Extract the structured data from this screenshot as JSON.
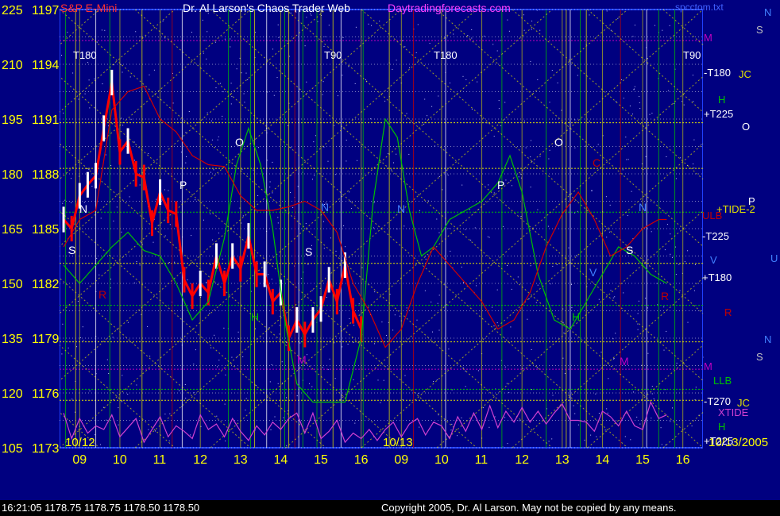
{
  "header": {
    "symbol": "S&P E-Mini",
    "title": "Dr. Al Larson's Chaos Trader Web",
    "site": "Daytradingforecasts.com",
    "file": "spcctom.txt"
  },
  "footer": {
    "quote": "16:21:05  1178.75 1178.75 1178.50 1178.50",
    "copyright": "Copyright 2005, Dr. Al Larson. May not be copied by any means."
  },
  "colors": {
    "background": "#000080",
    "axis_text": "#ffff00",
    "grid_yellow": "#e0e000",
    "grid_green": "#00c000",
    "grid_white": "#ffffff",
    "grid_magenta": "#c000c0",
    "grid_red": "#c00000",
    "price_bar_down": "#ff0000",
    "price_bar_up": "#ffffff",
    "cycle_green": "#00c000",
    "cycle_red": "#d00000",
    "tide_magenta": "#d040d0"
  },
  "chart_data": {
    "type": "line",
    "title": "S&P E-Mini",
    "y_left_labels": [
      "225",
      "210",
      "195",
      "180",
      "165",
      "150",
      "135",
      "120",
      "105"
    ],
    "y_price_labels": [
      "1197",
      "1194",
      "1191",
      "1188",
      "1185",
      "1182",
      "1179",
      "1176",
      "1173"
    ],
    "ylim": [
      1173,
      1197
    ],
    "x_tick_labels": [
      "09",
      "10",
      "11",
      "12",
      "13",
      "14",
      "15",
      "16",
      "09",
      "10",
      "11",
      "12",
      "13",
      "14",
      "15",
      "16"
    ],
    "date_labels": [
      "10/12",
      "10/13",
      "10/13/2005"
    ],
    "right_labels": [
      "N",
      "S",
      "M",
      "-T180",
      "JC",
      "H",
      "+T225",
      "O",
      "+TIDE-2",
      "P",
      "ULB",
      "-T225",
      "V",
      "U",
      "+T180",
      "R",
      "N",
      "S",
      "M",
      "LLB",
      "-T270",
      "JC",
      "XTIDE",
      "H",
      "+T225"
    ],
    "top_labels": [
      "T180",
      "T90",
      "T180",
      "T90"
    ],
    "chart_annotations": [
      "O",
      "P",
      "N",
      "S",
      "R",
      "H",
      "M",
      "N",
      "N",
      "O",
      "P",
      "N",
      "S",
      "H",
      "M",
      "C",
      "R",
      "V",
      "S"
    ],
    "series": [
      {
        "name": "S&P E-Mini",
        "x": [
          8.6,
          8.8,
          9.0,
          9.2,
          9.4,
          9.6,
          9.8,
          10.0,
          10.2,
          10.4,
          10.6,
          10.8,
          11.0,
          11.2,
          11.4,
          11.6,
          11.8,
          12.0,
          12.2,
          12.4,
          12.6,
          12.8,
          13.0,
          13.2,
          13.4,
          13.6,
          13.8,
          14.0,
          14.2,
          14.4,
          14.6,
          14.8,
          15.0,
          15.2,
          15.4,
          15.6,
          15.8,
          16.0
        ],
        "values": [
          1185.5,
          1185.0,
          1186.8,
          1187.4,
          1187.9,
          1190.5,
          1193.0,
          1189.2,
          1189.8,
          1188.0,
          1187.8,
          1185.3,
          1187.0,
          1186.0,
          1185.8,
          1182.2,
          1181.3,
          1182.0,
          1181.5,
          1183.5,
          1182.0,
          1183.5,
          1182.8,
          1184.6,
          1182.5,
          1182.5,
          1181.0,
          1181.5,
          1179.0,
          1180.0,
          1179.2,
          1180.0,
          1180.6,
          1182.2,
          1181.0,
          1183.0,
          1180.5,
          1179.5
        ]
      },
      {
        "name": "green cycle",
        "x": [
          8.6,
          9.0,
          9.4,
          9.8,
          10.2,
          10.6,
          11.0,
          11.4,
          11.8,
          12.2,
          12.6,
          12.9,
          13.2,
          13.5,
          13.8,
          14.1,
          14.4,
          14.8,
          15.2,
          15.6,
          16.0,
          16.3,
          16.6,
          16.9,
          17.2,
          17.5,
          17.8,
          18.2,
          18.6,
          19.0,
          19.4,
          19.7,
          20.0,
          20.4,
          20.8,
          21.2,
          21.6,
          22.0,
          22.4,
          22.8,
          23.2,
          23.6
        ],
        "values": [
          1183.0,
          1182.0,
          1183.0,
          1184.0,
          1184.8,
          1183.8,
          1183.5,
          1182.0,
          1180.0,
          1181.0,
          1184.5,
          1188.5,
          1190.5,
          1188.5,
          1185.0,
          1180.0,
          1176.5,
          1175.5,
          1175.5,
          1175.5,
          1179.0,
          1186.5,
          1191.0,
          1190.0,
          1186.0,
          1183.5,
          1184.0,
          1185.5,
          1186.0,
          1186.5,
          1187.5,
          1189.0,
          1187.0,
          1182.5,
          1180.0,
          1179.5,
          1181.0,
          1182.5,
          1184.0,
          1183.5,
          1182.5,
          1182.0
        ]
      },
      {
        "name": "red cycle",
        "x": [
          8.6,
          9.0,
          9.4,
          9.8,
          10.2,
          10.6,
          11.0,
          11.4,
          11.8,
          12.2,
          12.6,
          13.0,
          13.4,
          13.8,
          14.2,
          14.6,
          15.0,
          15.4,
          15.8,
          16.2,
          16.6,
          17.0,
          17.4,
          17.8,
          18.2,
          18.6,
          19.0,
          19.4,
          19.8,
          20.2,
          20.6,
          21.0,
          21.4,
          21.8,
          22.2,
          22.6,
          23.0,
          23.4,
          23.6
        ],
        "values": [
          1184.0,
          1185.5,
          1186.0,
          1191.5,
          1192.5,
          1192.8,
          1191.0,
          1190.3,
          1189.0,
          1188.5,
          1188.4,
          1186.8,
          1186.0,
          1186.0,
          1186.2,
          1186.5,
          1186.0,
          1184.8,
          1182.0,
          1180.5,
          1178.5,
          1179.5,
          1182.0,
          1184.0,
          1183.0,
          1182.0,
          1181.0,
          1179.5,
          1180.0,
          1181.5,
          1184.0,
          1185.8,
          1187.0,
          1185.5,
          1183.5,
          1184.0,
          1185.0,
          1185.5,
          1185.5
        ]
      },
      {
        "name": "XTIDE",
        "x": [
          8.6,
          8.8,
          9.0,
          9.2,
          9.4,
          9.6,
          9.8,
          10.0,
          10.2,
          10.4,
          10.6,
          10.8,
          11.0,
          11.2,
          11.4,
          11.6,
          11.8,
          12.0,
          12.2,
          12.4,
          12.6,
          12.8,
          13.0,
          13.2,
          13.4,
          13.6,
          13.8,
          14.0,
          14.2,
          14.4,
          14.6,
          14.8,
          15.0,
          15.2,
          15.4,
          15.6,
          15.8,
          16.0,
          16.2,
          16.4,
          16.6,
          16.8,
          17.0,
          17.2,
          17.4,
          17.6,
          17.8,
          18.0,
          18.2,
          18.4,
          18.6,
          18.8,
          19.0,
          19.2,
          19.4,
          19.6,
          19.8,
          20.0,
          20.2,
          20.4,
          20.6,
          20.8,
          21.0,
          21.2,
          21.4,
          21.6,
          21.8,
          22.0,
          22.2,
          22.4,
          22.6,
          22.8,
          23.0,
          23.2,
          23.4,
          23.6
        ],
        "values": [
          1174.9,
          1173.5,
          1174.6,
          1173.8,
          1174.2,
          1174.0,
          1174.8,
          1173.6,
          1174.1,
          1174.6,
          1173.3,
          1174.0,
          1174.7,
          1173.6,
          1174.2,
          1173.9,
          1173.5,
          1174.8,
          1174.0,
          1174.3,
          1173.6,
          1174.6,
          1173.9,
          1173.4,
          1174.2,
          1173.7,
          1174.4,
          1174.0,
          1174.6,
          1174.9,
          1173.8,
          1174.9,
          1173.5,
          1173.9,
          1174.5,
          1173.3,
          1173.8,
          1173.5,
          1174.0,
          1173.4,
          1174.0,
          1174.4,
          1173.6,
          1174.3,
          1174.6,
          1173.7,
          1174.4,
          1174.2,
          1173.5,
          1174.7,
          1173.9,
          1174.9,
          1174.0,
          1175.3,
          1174.1,
          1175.0,
          1174.4,
          1175.2,
          1174.4,
          1175.0,
          1174.3,
          1174.9,
          1175.4,
          1174.5,
          1174.5,
          1174.4,
          1173.9,
          1175.0,
          1174.7,
          1174.2,
          1175.0,
          1174.2,
          1174.0,
          1175.5,
          1174.6,
          1174.8
        ]
      }
    ],
    "grid": true
  }
}
